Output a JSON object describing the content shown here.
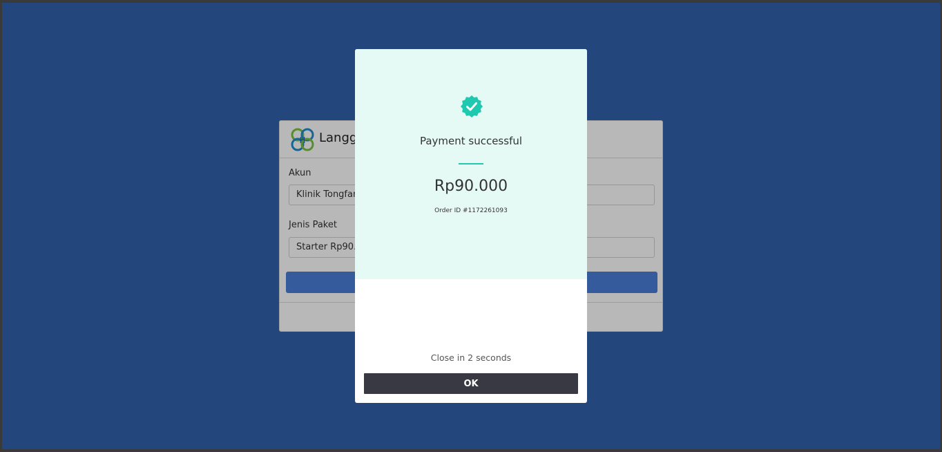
{
  "background_card": {
    "brand": "Langga",
    "fields": [
      {
        "label": "Akun",
        "value": "Klinik Tongfan"
      },
      {
        "label": "Jenis Paket",
        "value": "Starter Rp90.0"
      }
    ]
  },
  "modal": {
    "icon": "check-badge-icon",
    "title": "Payment successful",
    "amount": "Rp90.000",
    "order_id": "Order ID #1172261093",
    "countdown": "Close in 2 seconds",
    "ok_label": "OK"
  },
  "colors": {
    "page_bg": "#23477c",
    "modal_top_bg": "#e6faf5",
    "accent": "#1ec9b0",
    "ok_button": "#393943"
  }
}
